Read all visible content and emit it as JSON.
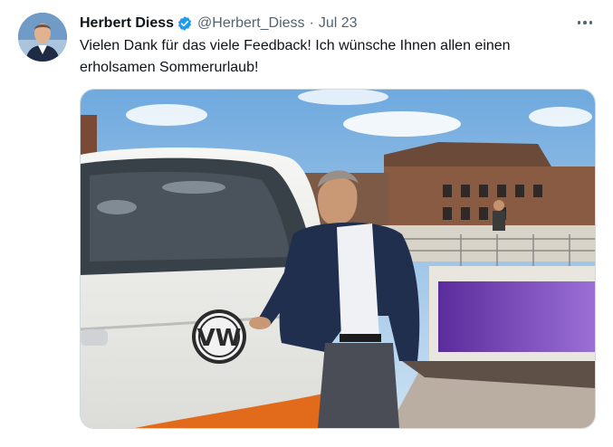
{
  "tweet": {
    "author": {
      "display_name": "Herbert Diess",
      "handle": "@Herbert_Diess",
      "verified": true,
      "avatar_icon": "person-portrait"
    },
    "separator": "·",
    "timestamp": "Jul 23",
    "text": "Vielen Dank für das viele Feedback! Ich wünsche Ihnen allen einen erholsamen Sommerurlaub!",
    "more_icon": "more-horizontal-icon",
    "media": {
      "kind": "photo",
      "logo_text": "VW"
    }
  },
  "colors": {
    "text_primary": "#0f1419",
    "text_secondary": "#536471",
    "verified_blue": "#1d9bf0",
    "border": "#cfd9de"
  }
}
